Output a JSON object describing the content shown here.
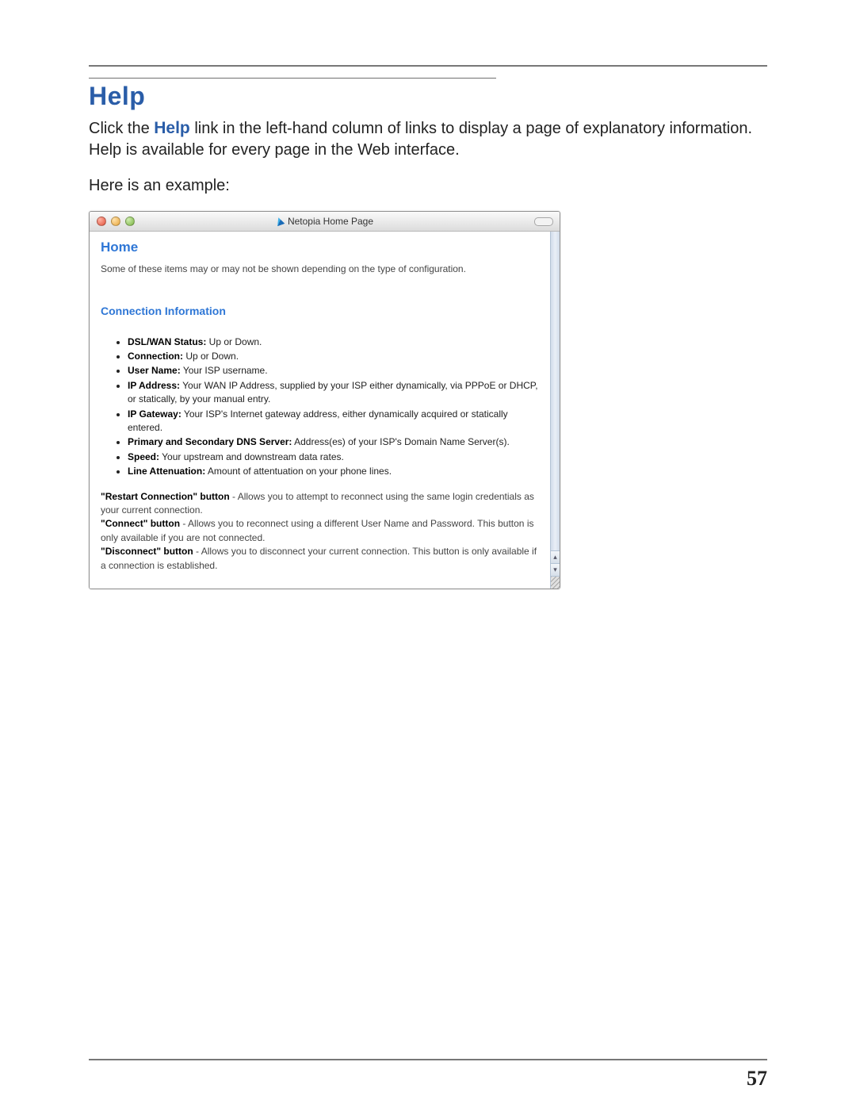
{
  "page_number": "57",
  "section_heading": "Help",
  "intro": {
    "prefix": "Click the ",
    "link_text": "Help",
    "suffix": " link in the left-hand column of links to display a page of explanatory information. Help is available for every page in the Web interface."
  },
  "example_lead": "Here is an example:",
  "window": {
    "title": "Netopia Home Page",
    "h2": "Home",
    "intro_para": "Some of these items may or may not be shown depending on the type of configuration.",
    "h3": "Connection Information",
    "items": [
      {
        "label": "DSL/WAN Status:",
        "desc": " Up or Down."
      },
      {
        "label": "Connection:",
        "desc": " Up or Down."
      },
      {
        "label": "User Name:",
        "desc": " Your ISP username."
      },
      {
        "label": "IP Address:",
        "desc": " Your WAN IP Address, supplied by your ISP either dynamically, via PPPoE or DHCP, or statically, by your manual entry."
      },
      {
        "label": "IP Gateway:",
        "desc": " Your ISP's Internet gateway address, either dynamically acquired or statically entered."
      },
      {
        "label": "Primary and Secondary DNS Server:",
        "desc": " Address(es) of your ISP's Domain Name Server(s)."
      },
      {
        "label": "Speed:",
        "desc": " Your upstream and downstream data rates."
      },
      {
        "label": "Line Attenuation:",
        "desc": " Amount of attentuation on your phone lines."
      }
    ],
    "buttons_para": [
      {
        "b": "\"Restart Connection\" button",
        "t": " - Allows you to attempt to reconnect using the same login credentials as your current connection."
      },
      {
        "b": "\"Connect\" button",
        "t": " - Allows you to reconnect using a different User Name and Password. This button is only available if you are not connected."
      },
      {
        "b": "\"Disconnect\" button",
        "t": " - Allows you to disconnect your current connection. This button is only available if a connection is established."
      }
    ],
    "scroll_up": "▴",
    "scroll_down": "▾"
  }
}
